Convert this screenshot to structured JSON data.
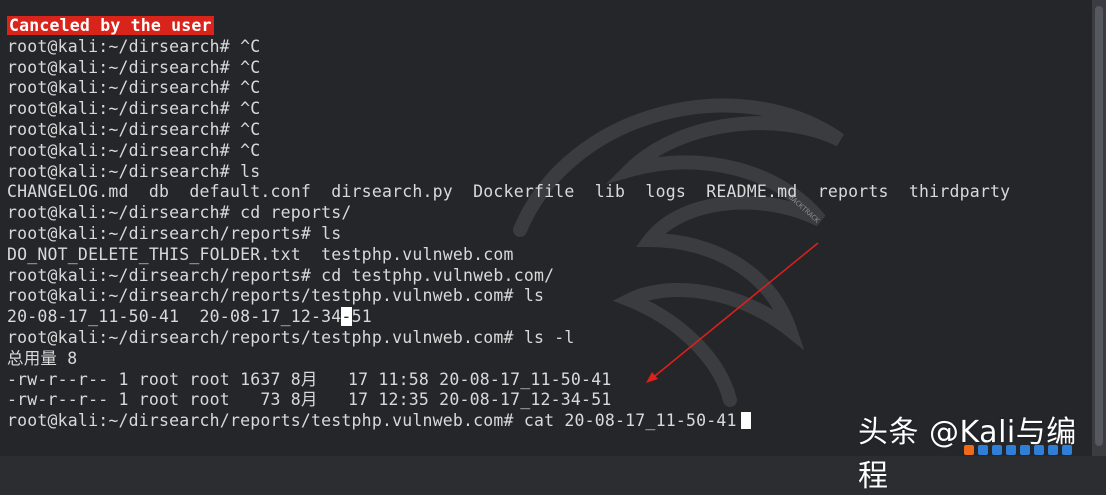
{
  "terminal": {
    "lines": [
      {
        "text": "Canceled by the user",
        "style": "banner"
      },
      {
        "text": "root@kali:~/dirsearch# ^C"
      },
      {
        "text": "root@kali:~/dirsearch# ^C"
      },
      {
        "text": "root@kali:~/dirsearch# ^C"
      },
      {
        "text": "root@kali:~/dirsearch# ^C"
      },
      {
        "text": "root@kali:~/dirsearch# ^C"
      },
      {
        "text": "root@kali:~/dirsearch# ^C"
      },
      {
        "text": "root@kali:~/dirsearch# ls"
      },
      {
        "text": "CHANGELOG.md  db  default.conf  dirsearch.py  Dockerfile  lib  logs  README.md  reports  thirdparty"
      },
      {
        "text": "root@kali:~/dirsearch# cd reports/"
      },
      {
        "text": "root@kali:~/dirsearch/reports# ls"
      },
      {
        "text": "DO_NOT_DELETE_THIS_FOLDER.txt  testphp.vulnweb.com"
      },
      {
        "text": "root@kali:~/dirsearch/reports# cd testphp.vulnweb.com/"
      },
      {
        "text": "root@kali:~/dirsearch/reports/testphp.vulnweb.com# ls"
      },
      {
        "text_before": "20-08-17_11-50-41  20-08-17_12-34",
        "text_cursor": "-",
        "text_after": "51",
        "style": "inline-cursor"
      },
      {
        "text": "root@kali:~/dirsearch/reports/testphp.vulnweb.com# ls -l"
      },
      {
        "text": "总用量 8"
      },
      {
        "text": "-rw-r--r-- 1 root root 1637 8月   17 11:58 20-08-17_11-50-41"
      },
      {
        "text": "-rw-r--r-- 1 root root   73 8月   17 12:35 20-08-17_12-34-51"
      },
      {
        "text": "root@kali:~/dirsearch/reports/testphp.vulnweb.com# cat 20-08-17_11-50-41",
        "style": "end-cursor"
      }
    ]
  },
  "watermark": "头条 @Kali与编程",
  "stamp": "BACKTRACK",
  "colors": {
    "background": "#24262a",
    "text": "#d9d9d9",
    "banner": "#d9241c",
    "arrow": "#e0201a"
  },
  "icons": {
    "ime": [
      "s-icon",
      "chinese-input-icon",
      "punctuation-icon",
      "emoji-icon",
      "mic-icon",
      "keyboard-icon",
      "skin-icon",
      "grid-icon"
    ]
  }
}
